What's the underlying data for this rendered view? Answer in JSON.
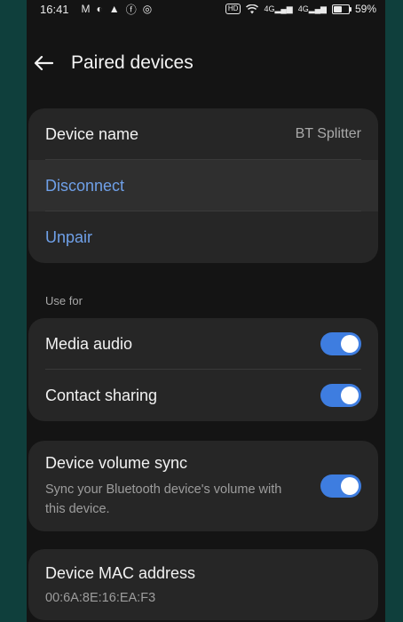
{
  "status_bar": {
    "time": "16:41",
    "left_icons": [
      "gmail-icon",
      "notification-icon",
      "drive-icon",
      "facebook-icon",
      "instagram-icon"
    ],
    "network_labels": [
      "4G",
      "4G"
    ],
    "battery": "59%",
    "battery_level": 0.59
  },
  "header": {
    "title": "Paired devices"
  },
  "device_card": {
    "name_label": "Device name",
    "name_value": "BT Splitter",
    "disconnect_label": "Disconnect",
    "unpair_label": "Unpair"
  },
  "use_for": {
    "section_label": "Use for",
    "media_audio_label": "Media audio",
    "media_audio_on": true,
    "contact_sharing_label": "Contact sharing",
    "contact_sharing_on": true
  },
  "volume_sync": {
    "label": "Device volume sync",
    "description": "Sync your Bluetooth device's volume with this device.",
    "on": true
  },
  "mac": {
    "label": "Device MAC address",
    "value": "00:6A:8E:16:EA:F3"
  },
  "colors": {
    "accent": "#3e7de0",
    "link": "#6fa0e8",
    "card": "#262626",
    "background": "#141414"
  }
}
